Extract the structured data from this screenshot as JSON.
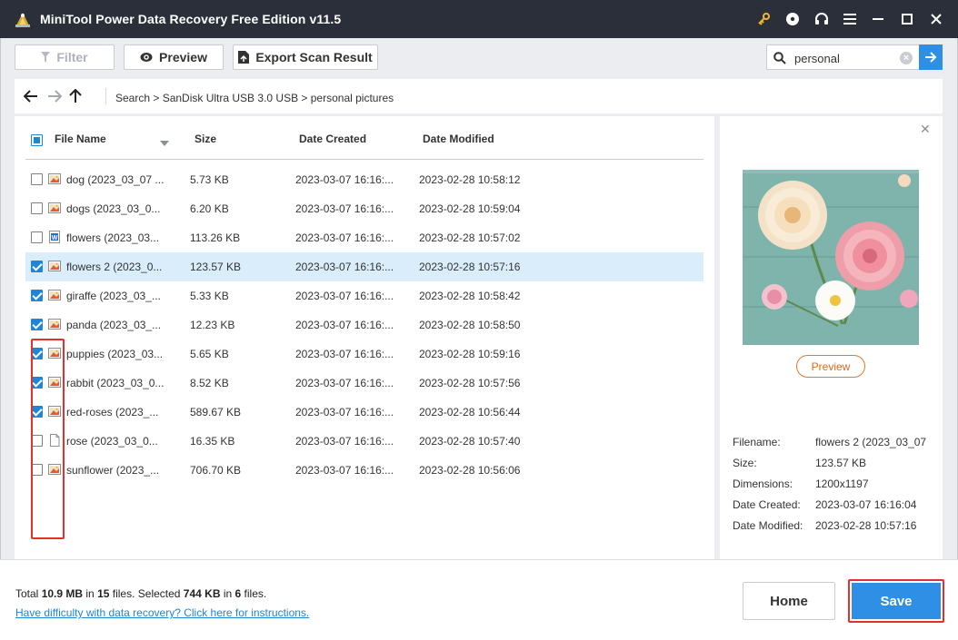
{
  "window": {
    "title": "MiniTool Power Data Recovery Free Edition v11.5",
    "controls": [
      "key-icon",
      "disc-icon",
      "headset-icon",
      "menu-icon",
      "minimize-icon",
      "maximize-icon",
      "close-icon"
    ]
  },
  "toolbar": {
    "filter_label": "Filter",
    "preview_label": "Preview",
    "export_label": "Export Scan Result",
    "search_value": "personal"
  },
  "breadcrumb": {
    "path": "Search > SanDisk Ultra USB 3.0 USB > personal pictures"
  },
  "columns": {
    "name": "File Name",
    "size": "Size",
    "created": "Date Created",
    "modified": "Date Modified"
  },
  "files": [
    {
      "name": "dog (2023_03_07 ...",
      "size": "5.73 KB",
      "created": "2023-03-07 16:16:...",
      "modified": "2023-02-28 10:58:12",
      "checked": false,
      "icon": "image-icon"
    },
    {
      "name": "dogs (2023_03_0...",
      "size": "6.20 KB",
      "created": "2023-03-07 16:16:...",
      "modified": "2023-02-28 10:59:04",
      "checked": false,
      "icon": "image-icon"
    },
    {
      "name": "flowers (2023_03...",
      "size": "113.26 KB",
      "created": "2023-03-07 16:16:...",
      "modified": "2023-02-28 10:57:02",
      "checked": false,
      "icon": "word-doc-icon"
    },
    {
      "name": "flowers 2 (2023_0...",
      "size": "123.57 KB",
      "created": "2023-03-07 16:16:...",
      "modified": "2023-02-28 10:57:16",
      "checked": true,
      "icon": "image-icon"
    },
    {
      "name": "giraffe (2023_03_...",
      "size": "5.33 KB",
      "created": "2023-03-07 16:16:...",
      "modified": "2023-02-28 10:58:42",
      "checked": true,
      "icon": "image-icon"
    },
    {
      "name": "panda (2023_03_...",
      "size": "12.23 KB",
      "created": "2023-03-07 16:16:...",
      "modified": "2023-02-28 10:58:50",
      "checked": true,
      "icon": "image-icon"
    },
    {
      "name": "puppies (2023_03...",
      "size": "5.65 KB",
      "created": "2023-03-07 16:16:...",
      "modified": "2023-02-28 10:59:16",
      "checked": true,
      "icon": "image-icon"
    },
    {
      "name": "rabbit (2023_03_0...",
      "size": "8.52 KB",
      "created": "2023-03-07 16:16:...",
      "modified": "2023-02-28 10:57:56",
      "checked": true,
      "icon": "image-icon"
    },
    {
      "name": "red-roses (2023_...",
      "size": "589.67 KB",
      "created": "2023-03-07 16:16:...",
      "modified": "2023-02-28 10:56:44",
      "checked": true,
      "icon": "image-icon"
    },
    {
      "name": "rose (2023_03_0...",
      "size": "16.35 KB",
      "created": "2023-03-07 16:16:...",
      "modified": "2023-02-28 10:57:40",
      "checked": false,
      "icon": "blank-file-icon"
    },
    {
      "name": "sunflower (2023_...",
      "size": "706.70 KB",
      "created": "2023-03-07 16:16:...",
      "modified": "2023-02-28 10:56:06",
      "checked": false,
      "icon": "image-icon"
    }
  ],
  "selected_index": 3,
  "preview": {
    "button_label": "Preview",
    "info": {
      "filename_label": "Filename:",
      "filename": "flowers 2 (2023_03_07",
      "size_label": "Size:",
      "size": "123.57 KB",
      "dimensions_label": "Dimensions:",
      "dimensions": "1200x1197",
      "created_label": "Date Created:",
      "created": "2023-03-07 16:16:04",
      "modified_label": "Date Modified:",
      "modified": "2023-02-28 10:57:16"
    }
  },
  "footer": {
    "total_prefix": "Total ",
    "total_size": "10.9 MB",
    "in1": " in ",
    "total_files": "15",
    "files1": " files.  Selected ",
    "selected_size": "744 KB",
    "in2": " in ",
    "selected_files": "6",
    "files2": " files.",
    "help_link": "Have difficulty with data recovery? Click here for instructions.",
    "home_label": "Home",
    "save_label": "Save"
  },
  "colors": {
    "titlebar": "#2b2f3a",
    "accent": "#2f8fe5",
    "highlight_outline": "#e0312f",
    "row_selected": "#d9edfa",
    "preview_button": "#e07a2b"
  }
}
